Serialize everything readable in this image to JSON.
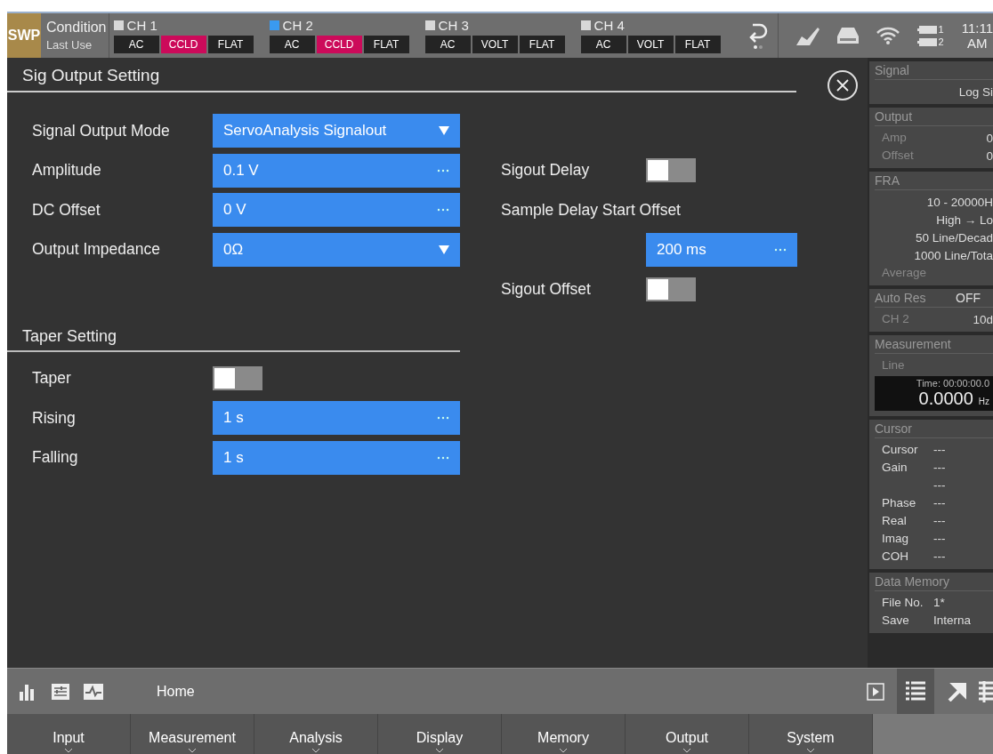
{
  "status_bar": {
    "mode": "SWP",
    "condition_label": "Condition",
    "condition_value": "Last Use",
    "channels": [
      {
        "name": "CH 1",
        "selected": false,
        "settings": [
          {
            "label": "AC",
            "on": false
          },
          {
            "label": "CCLD",
            "on": true
          },
          {
            "label": "FLAT",
            "on": false
          }
        ]
      },
      {
        "name": "CH 2",
        "selected": true,
        "settings": [
          {
            "label": "AC",
            "on": false
          },
          {
            "label": "CCLD",
            "on": true
          },
          {
            "label": "FLAT",
            "on": false
          }
        ]
      },
      {
        "name": "CH 3",
        "selected": false,
        "settings": [
          {
            "label": "AC",
            "on": false
          },
          {
            "label": "VOLT",
            "on": false
          },
          {
            "label": "FLAT",
            "on": false
          }
        ]
      },
      {
        "name": "CH 4",
        "selected": false,
        "settings": [
          {
            "label": "AC",
            "on": false
          },
          {
            "label": "VOLT",
            "on": false
          },
          {
            "label": "FLAT",
            "on": false
          }
        ]
      }
    ],
    "batteries": [
      "1",
      "2"
    ],
    "time": "11:11",
    "ampm": "AM"
  },
  "dialog": {
    "title": "Sig Output Setting",
    "output_fields": [
      {
        "label": "Signal Output Mode",
        "value": "ServoAnalysis Signalout",
        "kind": "dropdown"
      },
      {
        "label": "Amplitude",
        "value": "0.1 V",
        "kind": "input"
      },
      {
        "label": "DC Offset",
        "value": "0 V",
        "kind": "input"
      },
      {
        "label": "Output Impedance",
        "value": "0Ω",
        "kind": "dropdown"
      }
    ],
    "delay_settings": [
      {
        "kind": "toggle",
        "label": "Sigout Delay",
        "on": false
      },
      {
        "kind": "label",
        "label": "Sample Delay Start Offset"
      },
      {
        "kind": "input",
        "value": "200 ms"
      },
      {
        "kind": "toggle",
        "label": "Sigout Offset",
        "on": false
      }
    ],
    "taper_title": "Taper Setting",
    "taper_fields": [
      {
        "kind": "toggle",
        "label": "Taper",
        "on": false
      },
      {
        "kind": "input",
        "label": "Rising",
        "value": "1 s"
      },
      {
        "kind": "input",
        "label": "Falling",
        "value": "1 s"
      }
    ]
  },
  "sidebar": [
    {
      "title": "Signal",
      "rows": [
        {
          "value": "Log Si"
        }
      ]
    },
    {
      "title": "Output",
      "rows": [
        {
          "label": "Amp",
          "value": "0"
        },
        {
          "label": "Offset",
          "value": "0"
        }
      ]
    },
    {
      "title": "FRA",
      "rows": [
        {
          "value": "10 -  20000H"
        },
        {
          "value": "High → Lo"
        },
        {
          "value": "50 Line/Decad"
        },
        {
          "value": "1000 Line/Tota"
        },
        {
          "label": "Average"
        }
      ]
    },
    {
      "title": "Auto Res",
      "title_value": "OFF",
      "rows": [
        {
          "label": "CH 2",
          "value": "10d"
        }
      ]
    },
    {
      "title": "Measurement",
      "rows": [
        {
          "label": "Line"
        }
      ],
      "display": {
        "time": "Time: 00:00:00.0",
        "reading": "0.0000",
        "unit": "Hz"
      }
    },
    {
      "title": "Cursor",
      "rows": [
        {
          "label": "Cursor",
          "value": "---"
        },
        {
          "label": "Gain",
          "value": "---"
        },
        {
          "value": "---"
        },
        {
          "label": "Phase",
          "value": "---"
        },
        {
          "label": "Real",
          "value": "---"
        },
        {
          "label": "Imag",
          "value": "---"
        },
        {
          "label": "COH",
          "value": "---"
        }
      ],
      "kind": "list"
    },
    {
      "title": "Data Memory",
      "rows": [
        {
          "label": "File No.",
          "value": "1*"
        },
        {
          "label": "Save",
          "value": "Interna"
        }
      ],
      "kind": "list"
    }
  ],
  "toolbar": {
    "label": "Home"
  },
  "menu_tabs": [
    {
      "label": "Input"
    },
    {
      "label": "Measurement"
    },
    {
      "label": "Analysis"
    },
    {
      "label": "Display"
    },
    {
      "label": "Memory"
    },
    {
      "label": "Output"
    },
    {
      "label": "System"
    }
  ]
}
